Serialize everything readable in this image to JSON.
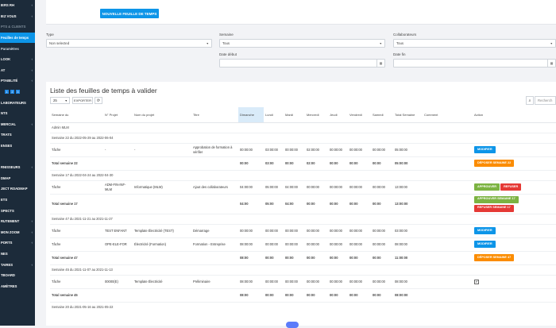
{
  "sidebar": {
    "items": [
      {
        "label": "IERS RH",
        "chev": "‹",
        "cls": ""
      },
      {
        "label": "IEZ VOUS",
        "chev": "‹",
        "cls": ""
      },
      {
        "label": "PTS & CLIENTS",
        "chev": "",
        "cls": "muted"
      },
      {
        "label": "Feuilles de temps",
        "chev": "",
        "cls": "active"
      },
      {
        "label": "Paramètres",
        "chev": "",
        "cls": "sub"
      },
      {
        "label": "LOOK",
        "chev": "‹",
        "cls": ""
      },
      {
        "label": "AT",
        "chev": "‹",
        "cls": ""
      },
      {
        "label": "PTABILITÉ",
        "chev": "‹",
        "cls": ""
      },
      {
        "label": "",
        "chev": "",
        "cls": "badges"
      },
      {
        "label": "LABORATEURS",
        "chev": "",
        "cls": ""
      },
      {
        "label": "NTS",
        "chev": "",
        "cls": ""
      },
      {
        "label": "MERCIAL",
        "chev": "‹",
        "cls": ""
      },
      {
        "label": "TRATS",
        "chev": "",
        "cls": ""
      },
      {
        "label": "ENSES",
        "chev": "",
        "cls": ""
      },
      {
        "label": "",
        "chev": "",
        "cls": "muted"
      },
      {
        "label": "RNISSEURS",
        "chev": "‹",
        "cls": ""
      },
      {
        "label": "DMAP",
        "chev": "",
        "cls": ""
      },
      {
        "label": "JECT ROADMAP",
        "chev": "",
        "cls": ""
      },
      {
        "label": "ETS",
        "chev": "",
        "cls": ""
      },
      {
        "label": "SPECTS",
        "chev": "",
        "cls": ""
      },
      {
        "label": "RUTEMENT",
        "chev": "‹",
        "cls": ""
      },
      {
        "label": "MON ZOOM",
        "chev": "‹",
        "cls": ""
      },
      {
        "label": "PORTS",
        "chev": "‹",
        "cls": ""
      },
      {
        "label": "NES",
        "chev": "",
        "cls": ""
      },
      {
        "label": "TAIRES",
        "chev": "‹",
        "cls": ""
      },
      {
        "label": "TBOARD",
        "chev": "",
        "cls": ""
      },
      {
        "label": "AMÈTRES",
        "chev": "",
        "cls": ""
      }
    ],
    "badges": [
      "1",
      "2",
      "3"
    ]
  },
  "top": {
    "new_sheet_label": "NOUVELLE FEUILLE DE TEMPS"
  },
  "filters": {
    "type_label": "Type",
    "type_value": "Non selected",
    "semaine_label": "Semaine",
    "semaine_value": "Tous",
    "collab_label": "Collaborateurs",
    "collab_value": "Tous",
    "date_debut_label": "Date début",
    "date_fin_label": "Date fin"
  },
  "card": {
    "title": "Liste des feuilles de temps à valider",
    "page_size": "25",
    "export_label": "EXPORTER",
    "search_placeholder": "Recherch"
  },
  "table": {
    "headers": [
      "Semaine du",
      "N° Projet",
      "Nom du projet",
      "Titre",
      "Dimanche",
      "Lundi",
      "Mardi",
      "Mercredi",
      "Jeudi",
      "Vendredi",
      "Samedi",
      "Total Semaine",
      "Comment",
      "Action"
    ],
    "rows": [
      {
        "kind": "grp",
        "cells": [
          "Admin MLM"
        ]
      },
      {
        "kind": "grp",
        "cells": [
          "Semaine 22 du 2022-05-29 au 2022-06-04"
        ]
      },
      {
        "kind": "row",
        "cells": [
          "Tâche",
          "-",
          "-",
          "Approbation de formation à vérifier",
          "00:00:00",
          "03:00:00",
          "00:00:00",
          "02:00:00",
          "00:00:00",
          "00:00:00",
          "00:00:00",
          "05:00:00",
          ""
        ],
        "actions": [
          {
            "label": "MODIFIER",
            "color": "b-blue"
          }
        ]
      },
      {
        "kind": "tot",
        "cells": [
          "Total semaine 22",
          "",
          "",
          "",
          "00:00",
          "03:00",
          "00:00",
          "02:00",
          "00:00",
          "00:00",
          "00:00",
          "05:00:00",
          ""
        ],
        "actions": [
          {
            "label": "DÉPOSER SEMAINE 22",
            "color": "b-orange"
          }
        ]
      },
      {
        "kind": "grp",
        "cells": [
          "Semaine 17 du 2022-04-24 au 2022-04-30"
        ]
      },
      {
        "kind": "row",
        "cells": [
          "Tâche",
          "ADM-FIN-INF-MLM",
          "Informatique (MLM)",
          "Ajout des collaborateurs",
          "04:00:00",
          "05:00:00",
          "04:00:00",
          "00:00:00",
          "00:00:00",
          "00:00:00",
          "00:00:00",
          "13:00:00",
          ""
        ],
        "actions": [
          {
            "label": "APPROUVER",
            "color": "b-green"
          },
          {
            "label": "REFUSER",
            "color": "b-red"
          }
        ]
      },
      {
        "kind": "tot",
        "cells": [
          "Total semaine 17",
          "",
          "",
          "",
          "04:00",
          "05:00",
          "04:00",
          "00:00",
          "00:00",
          "00:00",
          "00:00",
          "13:00:00",
          ""
        ],
        "actions": [
          {
            "label": "APPROUVER SEMAINE 17",
            "color": "b-green"
          },
          {
            "label": "REFUSER SEMAINE 17",
            "color": "b-red"
          }
        ]
      },
      {
        "kind": "grp",
        "cells": [
          "Semaine 47 du 2021-11-21 au 2021-11-27"
        ]
      },
      {
        "kind": "row",
        "cells": [
          "Tâche",
          "TEST ENFANT",
          "Template Électricité (TEST)",
          "Démarrage",
          "00:00:00",
          "00:00:00",
          "00:00:00",
          "00:00:00",
          "00:00:00",
          "00:00:00",
          "00:00:00",
          "03:00:00",
          ""
        ],
        "actions": [
          {
            "label": "MODIFIER",
            "color": "b-blue"
          }
        ]
      },
      {
        "kind": "row",
        "cells": [
          "Tâche",
          "OPE-ELE-FOR",
          "Électricité (Formation)",
          "Formation - Entreprise",
          "08:00:00",
          "00:00:00",
          "00:00:00",
          "00:00:00",
          "00:00:00",
          "00:00:00",
          "00:00:00",
          "08:00:00",
          ""
        ],
        "actions": [
          {
            "label": "MODIFIER",
            "color": "b-blue"
          }
        ]
      },
      {
        "kind": "tot",
        "cells": [
          "Total semaine 47",
          "",
          "",
          "",
          "08:00",
          "00:00",
          "00:00",
          "00:00",
          "00:00",
          "00:00",
          "00:00",
          "11:00:00",
          ""
        ],
        "actions": [
          {
            "label": "DÉPOSER SEMAINE 47",
            "color": "b-orange"
          }
        ]
      },
      {
        "kind": "grp",
        "cells": [
          "Semaine 45 du 2021-11-07 au 2021-11-13"
        ]
      },
      {
        "kind": "row",
        "cells": [
          "Tâche",
          "00000(E)",
          "Template Électricité",
          "Préliminaire",
          "08:00:00",
          "00:00:00",
          "00:00:00",
          "00:00:00",
          "00:00:00",
          "00:00:00",
          "00:00:00",
          "08:00:00",
          ""
        ],
        "check": "✔"
      },
      {
        "kind": "tot",
        "cells": [
          "Total semaine 45",
          "",
          "",
          "",
          "08:00",
          "00:00",
          "00:00",
          "00:00",
          "00:00",
          "00:00",
          "00:00",
          "08:00:00",
          ""
        ]
      },
      {
        "kind": "grp",
        "cells": [
          "Semaine 20 du 2021-05-16 au 2021-05-22"
        ]
      }
    ]
  }
}
